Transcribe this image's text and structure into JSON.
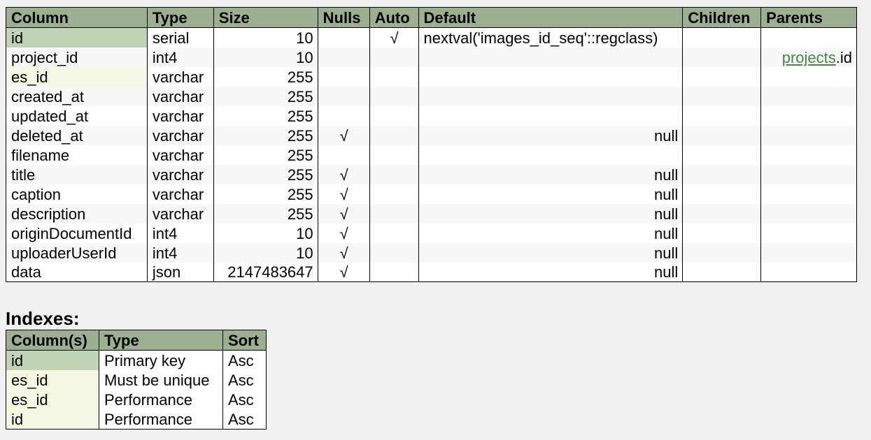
{
  "columns_table": {
    "headers": [
      "Column",
      "Type",
      "Size",
      "Nulls",
      "Auto",
      "Default",
      "Children",
      "Parents"
    ],
    "rows": [
      {
        "column": "id",
        "type": "serial",
        "size": "10",
        "nulls": "",
        "auto": "√",
        "default": "nextval('images_id_seq'::regclass)",
        "children": "",
        "parent_table": "",
        "parent_col": "",
        "key": "pk"
      },
      {
        "column": "project_id",
        "type": "int4",
        "size": "10",
        "nulls": "",
        "auto": "",
        "default": "",
        "children": "",
        "parent_table": "projects",
        "parent_col": ".id",
        "key": ""
      },
      {
        "column": "es_id",
        "type": "varchar",
        "size": "255",
        "nulls": "",
        "auto": "",
        "default": "",
        "children": "",
        "parent_table": "",
        "parent_col": "",
        "key": "uk"
      },
      {
        "column": "created_at",
        "type": "varchar",
        "size": "255",
        "nulls": "",
        "auto": "",
        "default": "",
        "children": "",
        "parent_table": "",
        "parent_col": "",
        "key": ""
      },
      {
        "column": "updated_at",
        "type": "varchar",
        "size": "255",
        "nulls": "",
        "auto": "",
        "default": "",
        "children": "",
        "parent_table": "",
        "parent_col": "",
        "key": ""
      },
      {
        "column": "deleted_at",
        "type": "varchar",
        "size": "255",
        "nulls": "√",
        "auto": "",
        "default": "null",
        "children": "",
        "parent_table": "",
        "parent_col": "",
        "key": ""
      },
      {
        "column": "filename",
        "type": "varchar",
        "size": "255",
        "nulls": "",
        "auto": "",
        "default": "",
        "children": "",
        "parent_table": "",
        "parent_col": "",
        "key": ""
      },
      {
        "column": "title",
        "type": "varchar",
        "size": "255",
        "nulls": "√",
        "auto": "",
        "default": "null",
        "children": "",
        "parent_table": "",
        "parent_col": "",
        "key": ""
      },
      {
        "column": "caption",
        "type": "varchar",
        "size": "255",
        "nulls": "√",
        "auto": "",
        "default": "null",
        "children": "",
        "parent_table": "",
        "parent_col": "",
        "key": ""
      },
      {
        "column": "description",
        "type": "varchar",
        "size": "255",
        "nulls": "√",
        "auto": "",
        "default": "null",
        "children": "",
        "parent_table": "",
        "parent_col": "",
        "key": ""
      },
      {
        "column": "originDocumentId",
        "type": "int4",
        "size": "10",
        "nulls": "√",
        "auto": "",
        "default": "null",
        "children": "",
        "parent_table": "",
        "parent_col": "",
        "key": ""
      },
      {
        "column": "uploaderUserId",
        "type": "int4",
        "size": "10",
        "nulls": "√",
        "auto": "",
        "default": "null",
        "children": "",
        "parent_table": "",
        "parent_col": "",
        "key": ""
      },
      {
        "column": "data",
        "type": "json",
        "size": "2147483647",
        "nulls": "√",
        "auto": "",
        "default": "null",
        "children": "",
        "parent_table": "",
        "parent_col": "",
        "key": ""
      }
    ]
  },
  "indexes": {
    "title": "Indexes:",
    "headers": [
      "Column(s)",
      "Type",
      "Sort"
    ],
    "rows": [
      {
        "columns": "id",
        "type": "Primary key",
        "sort": "Asc",
        "key": "pk"
      },
      {
        "columns": "es_id",
        "type": "Must be unique",
        "sort": "Asc",
        "key": "uk"
      },
      {
        "columns": "es_id",
        "type": "Performance",
        "sort": "Asc",
        "key": "uk"
      },
      {
        "columns": "id",
        "type": "Performance",
        "sort": "Asc",
        "key": "uk"
      }
    ]
  },
  "colors": {
    "header_bg": "#9caf8f",
    "primary_key_bg": "#bfd4b4",
    "unique_key_bg": "#f4f7e1",
    "link": "#448844"
  }
}
